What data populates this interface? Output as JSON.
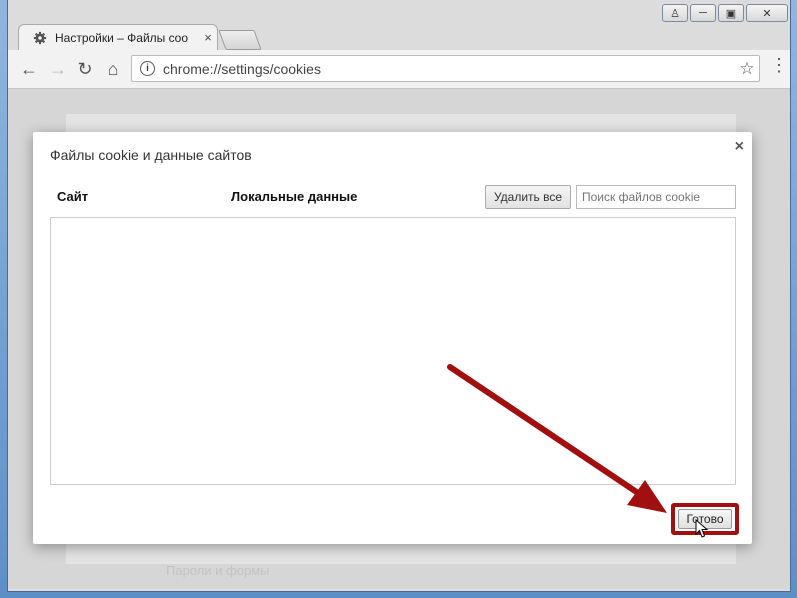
{
  "window": {
    "buttons": [
      {
        "name": "user-icon",
        "glyph": "♙"
      },
      {
        "name": "minimize-icon",
        "glyph": "─"
      },
      {
        "name": "maximize-icon",
        "glyph": "▣"
      },
      {
        "name": "close-icon",
        "glyph": "✕"
      }
    ]
  },
  "tab": {
    "title": "Настройки – Файлы coo",
    "close": "×"
  },
  "toolbar": {
    "back": "←",
    "forward": "→",
    "reload": "↻",
    "home": "⌂",
    "url": "chrome://settings/cookies",
    "star": "☆",
    "menu": "⋮"
  },
  "background": {
    "text": "Пароли и формы",
    "close": "×"
  },
  "dialog": {
    "title": "Файлы cookie и данные сайтов",
    "close": "×",
    "col_site": "Сайт",
    "col_local": "Локальные данные",
    "delete_all": "Удалить все",
    "search_placeholder": "Поиск файлов cookie",
    "done": "Готово"
  },
  "colors": {
    "annotation": "#a10f0f"
  }
}
